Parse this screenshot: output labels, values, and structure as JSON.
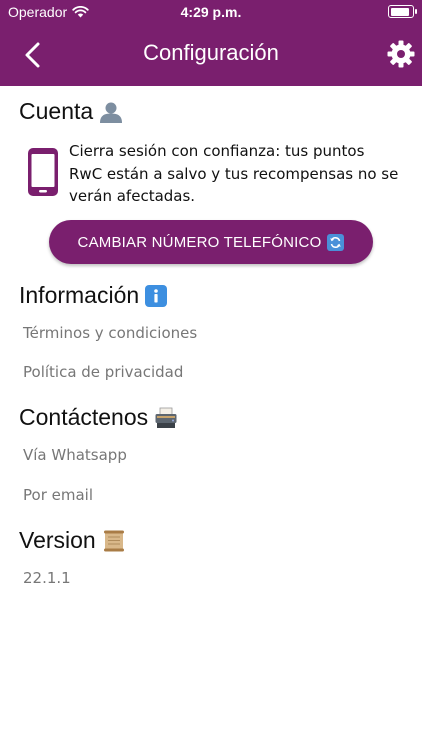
{
  "status_bar": {
    "carrier": "Operador",
    "time": "4:29 p.m.",
    "battery_level": 0.9
  },
  "nav": {
    "title": "Configuración",
    "back_icon": "chevron-left-icon",
    "settings_icon": "gear-icon"
  },
  "account": {
    "title": "Cuenta",
    "title_icon": "user-silhouette-icon",
    "device_icon": "phone-icon",
    "description": "Cierra sesión con confianza: tus puntos RwC están a salvo y tus recompensas no se verán afectadas.",
    "change_phone_label": "CAMBIAR NÚMERO TELEFÓNICO",
    "change_phone_icon": "refresh-icon"
  },
  "information": {
    "title": "Información",
    "title_icon": "info-icon",
    "items": [
      "Términos y condiciones",
      "Política de privacidad"
    ]
  },
  "contact": {
    "title": "Contáctenos",
    "title_icon": "fax-machine-icon",
    "items": [
      "Vía Whatsapp",
      "Por email"
    ]
  },
  "version": {
    "title": "Version",
    "title_icon": "scroll-icon",
    "number": "22.1.1"
  },
  "colors": {
    "brand": "#7a1f6e",
    "text": "#111111",
    "muted": "#777777"
  }
}
